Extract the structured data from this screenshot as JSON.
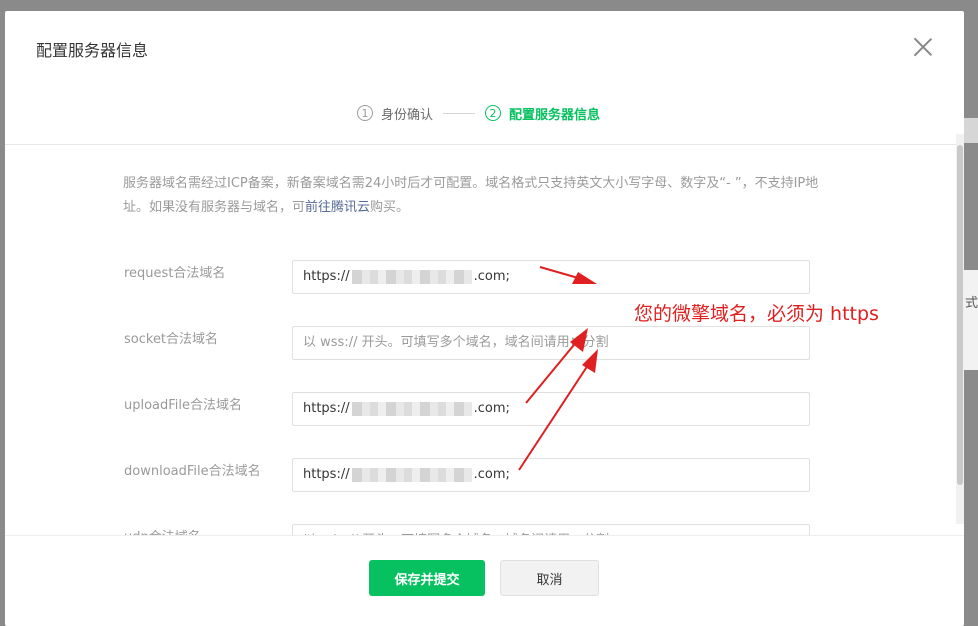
{
  "background": {
    "side_text": "式"
  },
  "modal": {
    "title": "配置服务器信息",
    "close_icon": "close-icon"
  },
  "steps": [
    {
      "num": "①",
      "label": "身份确认",
      "active": false
    },
    {
      "num": "②",
      "label": "配置服务器信息",
      "active": true
    }
  ],
  "notice": {
    "text_before_link": "服务器域名需经过ICP备案，新备案域名需24小时后才可配置。域名格式只支持英文大小写字母、数字及“- ”，不支持IP地址。如果没有服务器与域名，可",
    "link": "前往腾讯云",
    "text_after_link": "购买。"
  },
  "fields": {
    "request": {
      "label": "request合法域名",
      "prefix": "https://",
      "suffix": ".com;"
    },
    "socket": {
      "label": "socket合法域名",
      "placeholder": "以 wss:// 开头。可填写多个域名，域名间请用；分割"
    },
    "uploadFile": {
      "label": "uploadFile合法域名",
      "prefix": "https://",
      "suffix": ".com;"
    },
    "downloadFile": {
      "label": "downloadFile合法域名",
      "prefix": "https://",
      "suffix": ".com;"
    },
    "udp": {
      "label": "udp合法域名",
      "placeholder": "以 udp:// 开头。可填写多个域名，域名间请用；分割"
    }
  },
  "annotation": {
    "text": "您的微擎域名，必须为 https",
    "color": "#e02020"
  },
  "buttons": {
    "save": "保存并提交",
    "cancel": "取消"
  },
  "colors": {
    "accent": "#07c160",
    "link": "#576b95"
  }
}
